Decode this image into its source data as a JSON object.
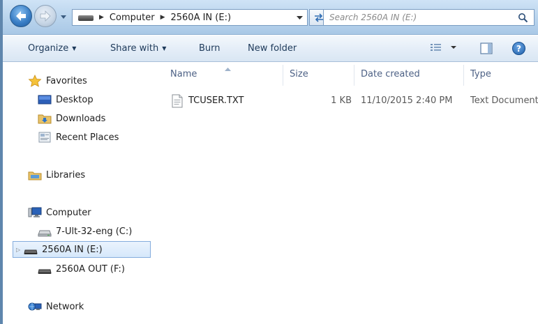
{
  "window": {
    "address": {
      "segments": [
        "Computer",
        "2560A IN (E:)"
      ]
    },
    "search": {
      "placeholder": "Search 2560A IN (E:)"
    },
    "icons": {
      "back": "back-arrow-icon",
      "forward": "forward-arrow-icon",
      "refresh": "refresh-icon",
      "search": "magnifier-icon",
      "help": "help-icon"
    },
    "colors": {
      "accent": "#3b7fc6",
      "selection": "#d6e8fb",
      "header_text": "#4d6185"
    }
  },
  "toolbar": {
    "organize": "Organize",
    "share_with": "Share with",
    "burn": "Burn",
    "new_folder": "New folder",
    "help": "?"
  },
  "navigation": {
    "favorites": {
      "label": "Favorites",
      "items": [
        "Desktop",
        "Downloads",
        "Recent Places"
      ]
    },
    "libraries": {
      "label": "Libraries"
    },
    "computer": {
      "label": "Computer",
      "drives": [
        "7-Ult-32-eng (C:)",
        "2560A IN (E:)",
        "2560A OUT (F:)"
      ],
      "selected": "2560A IN (E:)"
    },
    "network": {
      "label": "Network"
    }
  },
  "file_list": {
    "columns": [
      "Name",
      "Size",
      "Date created",
      "Type"
    ],
    "rows": [
      {
        "name": "TCUSER.TXT",
        "size": "1 KB",
        "date_created": "11/10/2015 2:40 PM",
        "type": "Text Document"
      }
    ]
  }
}
